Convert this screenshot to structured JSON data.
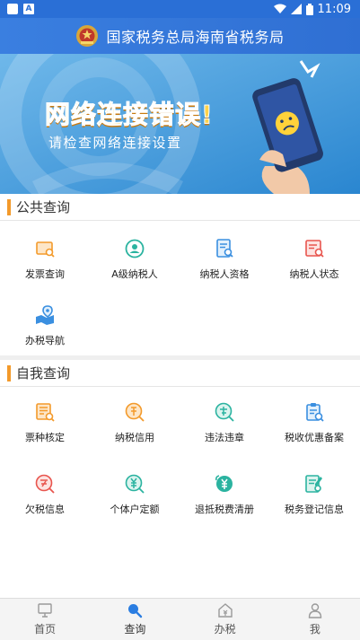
{
  "statusbar": {
    "time": "11:09"
  },
  "header": {
    "title": "国家税务总局海南省税务局"
  },
  "banner": {
    "title": "网络连接错误!",
    "subtitle": "请检查网络连接设置"
  },
  "sections": {
    "public": {
      "title": "公共查询",
      "items": [
        "发票查询",
        "A级纳税人",
        "纳税人资格",
        "纳税人状态",
        "办税导航"
      ]
    },
    "self": {
      "title": "自我查询",
      "items": [
        "票种核定",
        "纳税信用",
        "违法违章",
        "税收优惠备案",
        "欠税信息",
        "个体户定额",
        "退抵税费清册",
        "税务登记信息"
      ]
    }
  },
  "bottomnav": {
    "items": [
      "首页",
      "查询",
      "办税",
      "我"
    ],
    "active": "查询"
  },
  "colors": {
    "header": "#2f6fd3",
    "accent_orange": "#f39a2b",
    "icon_teal": "#2bb3a0",
    "icon_blue": "#3a8fe0",
    "icon_red": "#e8554e",
    "nav_active": "#2a7de1"
  },
  "icons": {
    "public": [
      "invoice-search-icon",
      "a-level-taxpayer-icon",
      "taxpayer-qualification-icon",
      "taxpayer-status-icon",
      "tax-navigation-icon"
    ],
    "self": [
      "ticket-type-icon",
      "tax-credit-icon",
      "violation-icon",
      "tax-preference-icon",
      "tax-arrears-icon",
      "individual-quota-icon",
      "refund-list-icon",
      "tax-registration-icon"
    ],
    "nav": [
      "home-icon",
      "search-icon",
      "tax-service-icon",
      "user-icon"
    ]
  }
}
